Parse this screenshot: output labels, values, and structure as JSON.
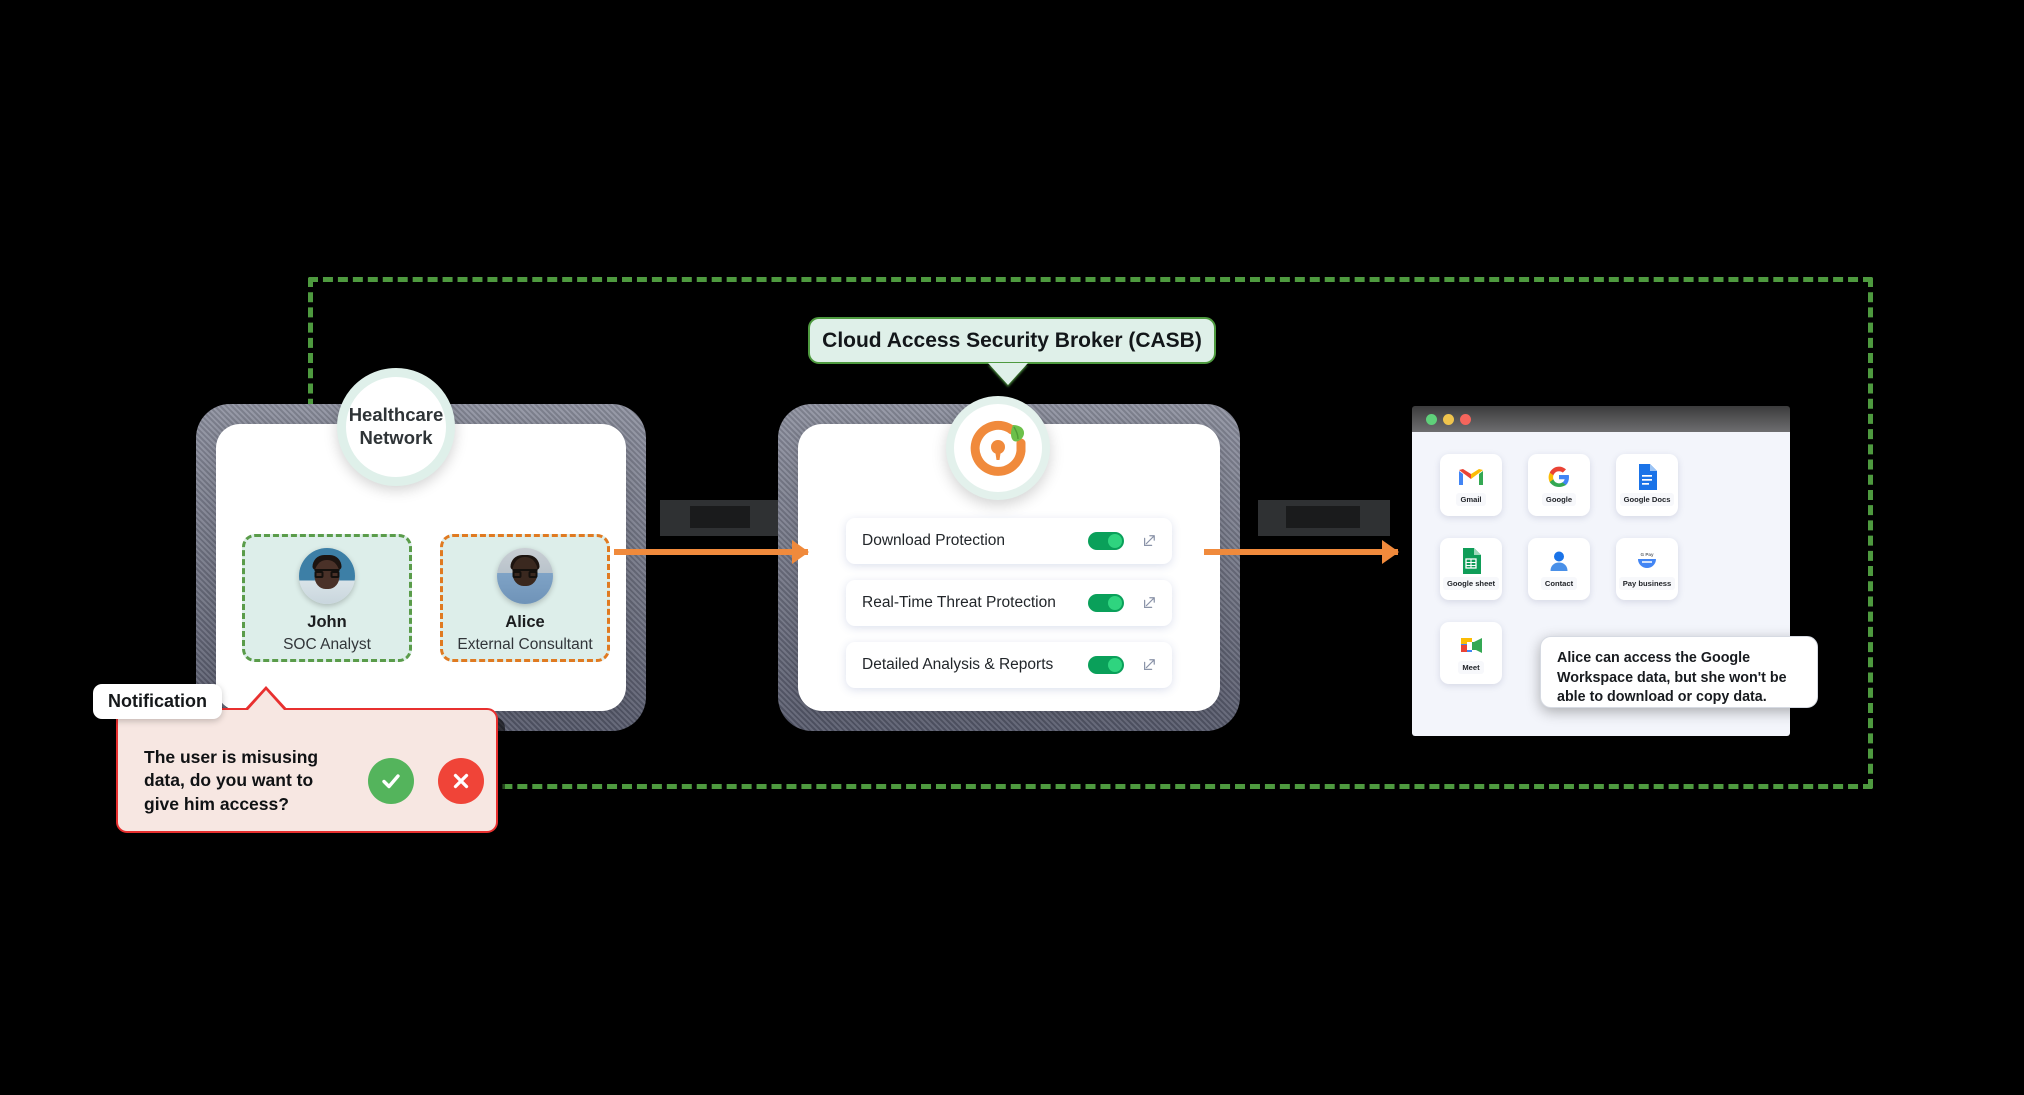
{
  "diagram": {
    "boundary_color": "#4e9a3f",
    "accent_orange": "#f08a3c"
  },
  "left_panel": {
    "network_badge": {
      "line1": "Healthcare",
      "line2": "Network"
    },
    "users": [
      {
        "name": "John",
        "role": "SOC Analyst",
        "border": "green",
        "border_color": "#5a9c4a"
      },
      {
        "name": "Alice",
        "role": "External Consultant",
        "border": "orange",
        "border_color": "#e07a21"
      }
    ]
  },
  "notification": {
    "tab_label": "Notification",
    "message": "The user is misusing data, do you want to give him access?",
    "accept_icon": "check-icon",
    "reject_icon": "cross-icon",
    "accept_color": "#54b45c",
    "reject_color": "#f04438",
    "border_color": "#e8302f",
    "background": "#f7e7e2"
  },
  "casb": {
    "label": "Cloud Access Security Broker (CASB)",
    "logo_icon": "casb-shield-lock-leaf-icon",
    "features": [
      {
        "label": "Download Protection",
        "enabled": true,
        "action_icon": "expand-icon"
      },
      {
        "label": "Real-Time Threat Protection",
        "enabled": true,
        "action_icon": "expand-icon"
      },
      {
        "label": "Detailed Analysis & Reports",
        "enabled": true,
        "action_icon": "expand-icon"
      }
    ],
    "toggle_on_color": "#0aa05a"
  },
  "arrows": [
    {
      "label": "",
      "redacted": true
    },
    {
      "label": "",
      "redacted": true
    }
  ],
  "workspace": {
    "window_dots": [
      "#5fd07a",
      "#efc44d",
      "#f5655c"
    ],
    "apps": [
      {
        "name": "Gmail",
        "icon": "gmail-icon"
      },
      {
        "name": "Google",
        "icon": "google-icon"
      },
      {
        "name": "Google Docs",
        "icon": "google-docs-icon"
      },
      {
        "name": "Google sheet",
        "icon": "google-sheets-icon"
      },
      {
        "name": "Contact",
        "icon": "contacts-icon"
      },
      {
        "name": "Pay business",
        "icon": "google-pay-icon"
      },
      {
        "name": "Meet",
        "icon": "google-meet-icon"
      }
    ],
    "cursor_icon": "mouse-pointer-icon",
    "tooltip": "Alice can access the Google Workspace data, but she won't be able to download or copy data."
  }
}
